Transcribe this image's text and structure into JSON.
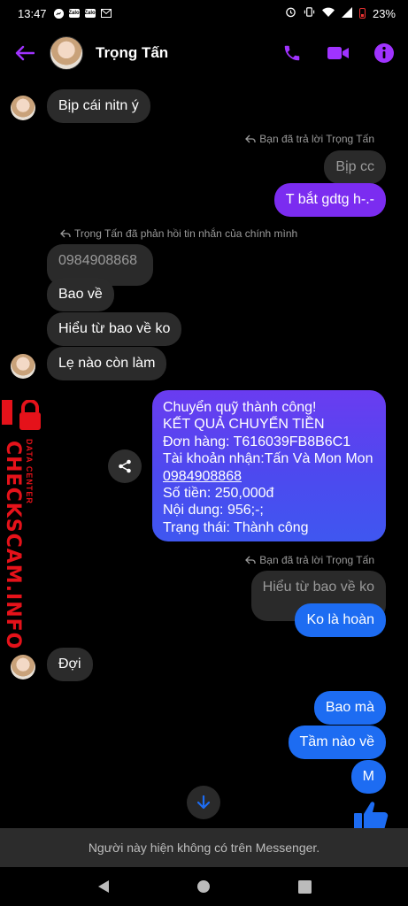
{
  "status_bar": {
    "time": "13:47",
    "notif_icons": [
      "messenger-icon",
      "zalo-icon",
      "zalo-icon",
      "gmail-icon"
    ],
    "zalo_label": "Zalo",
    "battery": "23%"
  },
  "header": {
    "contact_name": "Trọng Tấn"
  },
  "messages": {
    "m1": "Bịp cái nitn ý",
    "reply_note_1": "Bạn đã trả lời Trọng Tấn",
    "quote_1": "Bịp cc",
    "m2": "T bắt gdtg h-.-",
    "reply_note_2": "Trọng Tấn đã phản hồi tin nhắn của chính mình",
    "quote_2": "0984908868",
    "m3": "Bao về",
    "m4": "Hiểu từ bao về ko",
    "m5": "Lẹ nào còn làm",
    "transfer": {
      "line1": "Chuyển quỹ thành công!",
      "line2": "KẾT QUẢ CHUYỂN TIỀN",
      "line3": "Đơn hàng: T616039FB8B6C1",
      "line4": "Tài khoản nhận:Tấn Và Mon Mon",
      "line5": "0984908868",
      "line6": "Số tiền:  250,000đ",
      "line7": "Nội dung:  956;-;",
      "line8": "Trạng thái:   Thành công"
    },
    "reply_note_3": "Bạn đã trả lời Trọng Tấn",
    "quote_3": "Hiểu từ bao về ko",
    "m6": "Ko là hoàn",
    "m7": "Đợi",
    "m8": "Bao mà",
    "m9": "Tầm nào về",
    "m10": "M"
  },
  "watermark": {
    "main": "CHECKSCAM.INFO",
    "sub": "DATA CENTER"
  },
  "footer": {
    "unavailable": "Người này hiện không có trên Messenger."
  },
  "colors": {
    "accent": "#a033ff",
    "outgoing": "#1d6cf2",
    "incoming": "#2b2b2b",
    "watermark": "#e5121a"
  }
}
